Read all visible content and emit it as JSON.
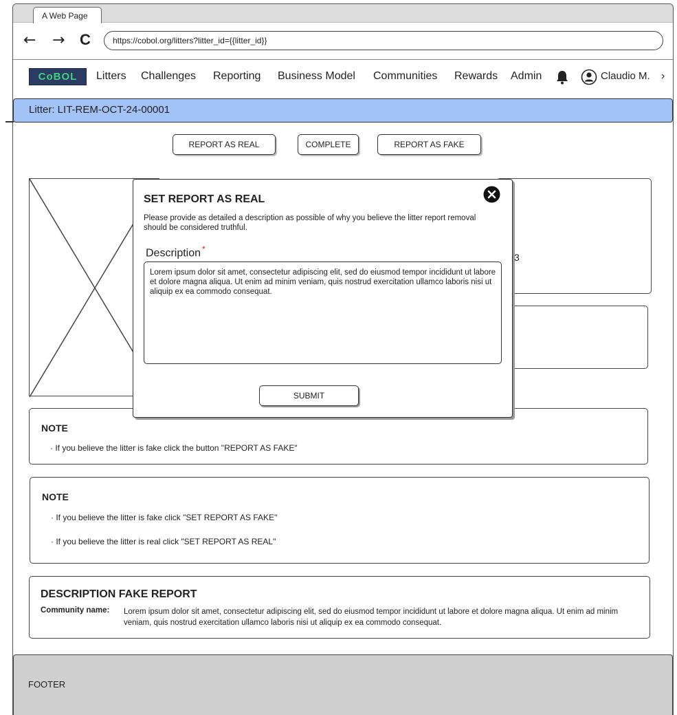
{
  "browser": {
    "tab_title": "A Web Page",
    "url": "https://cobol.org/litters?litter_id={{litter_id}}",
    "back_glyph": "←",
    "forward_glyph": "→",
    "reload_glyph": "C"
  },
  "nav": {
    "logo": "CoBOL",
    "items": [
      "Litters",
      "Challenges",
      "Reporting",
      "Business Model",
      "Communities",
      "Rewards",
      "Admin"
    ],
    "user_name": "Claudio M.",
    "chevron": "›"
  },
  "litter_bar": {
    "label": "Litter: LIT-REM-OCT-24-00001"
  },
  "actions": {
    "report_real": "REPORT AS REAL",
    "complete": "COMPLETE",
    "report_fake": "REPORT AS FAKE"
  },
  "background_partial_text": "3",
  "modal": {
    "title": "SET REPORT AS REAL",
    "description": "Please provide as detailed a description as possible of why you believe the litter report removal should be considered truthful.",
    "field_label": "Description",
    "required_mark": "*",
    "field_value": "Lorem ipsum dolor sit amet, consectetur adipiscing elit, sed do eiusmod tempor incididunt ut labore et dolore magna aliqua. Ut enim ad minim veniam, quis nostrud exercitation ullamco laboris nisi ut aliquip ex ea commodo consequat.",
    "submit_label": "SUBMIT"
  },
  "note1": {
    "title": "NOTE",
    "bullets": [
      "If you believe the litter is fake click the button \"REPORT AS FAKE\""
    ]
  },
  "note2": {
    "title": "NOTE",
    "bullets": [
      "If you believe the litter is fake click \"SET REPORT AS FAKE\"",
      "If you believe the litter is real click \"SET REPORT AS REAL\""
    ]
  },
  "fake_report": {
    "title": "DESCRIPTION FAKE REPORT",
    "community_label": "Community name:",
    "community_value": "Lorem ipsum dolor sit amet, consectetur adipiscing elit, sed do eiusmod tempor incididunt ut labore et dolore magna aliqua. Ut enim ad minim veniam, quis nostrud exercitation ullamco laboris nisi ut aliquip ex ea commodo consequat."
  },
  "footer": {
    "label": "FOOTER"
  },
  "colors": {
    "logo_bg": "#2b3b62",
    "logo_text": "#3fd27f",
    "litter_bar": "#a3c3f7",
    "footer": "#cfcfcf",
    "required": "#e2231a"
  }
}
